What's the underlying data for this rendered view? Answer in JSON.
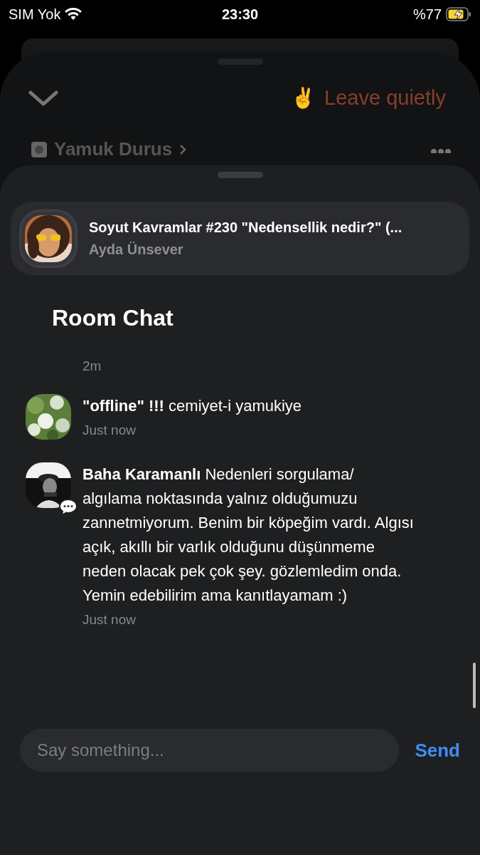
{
  "status_bar": {
    "carrier": "SIM Yok",
    "time": "23:30",
    "battery": "%77"
  },
  "background_sheet": {
    "leave_button": {
      "emoji": "✌️",
      "label": "Leave quietly"
    },
    "club": "Yamuk Durus"
  },
  "room_card": {
    "title": "Soyut Kavramlar #230 \"Nedensellik nedir?\" (...",
    "host": "Ayda Ünsever"
  },
  "chat": {
    "title": "Room Chat",
    "earlier_time": "2m",
    "messages": [
      {
        "name": "\"offline\" !!!",
        "text": "cemiyet-i yamukiye",
        "time": "Just now",
        "badge": false
      },
      {
        "name": "Baha Karamanlı",
        "text": "Nedenleri sorgulama/ algılama noktasında yalnız olduğumuzu zannetmiyorum. Benim bir köpeğim vardı. Algısı açık, akıllı bir varlık olduğunu düşünmeme neden olacak pek çok şey. gözlemledim onda. Yemin edebilirim ama kanıtlayamam :)",
        "time": "Just now",
        "badge": true
      }
    ]
  },
  "composer": {
    "placeholder": "Say something...",
    "send": "Send"
  }
}
